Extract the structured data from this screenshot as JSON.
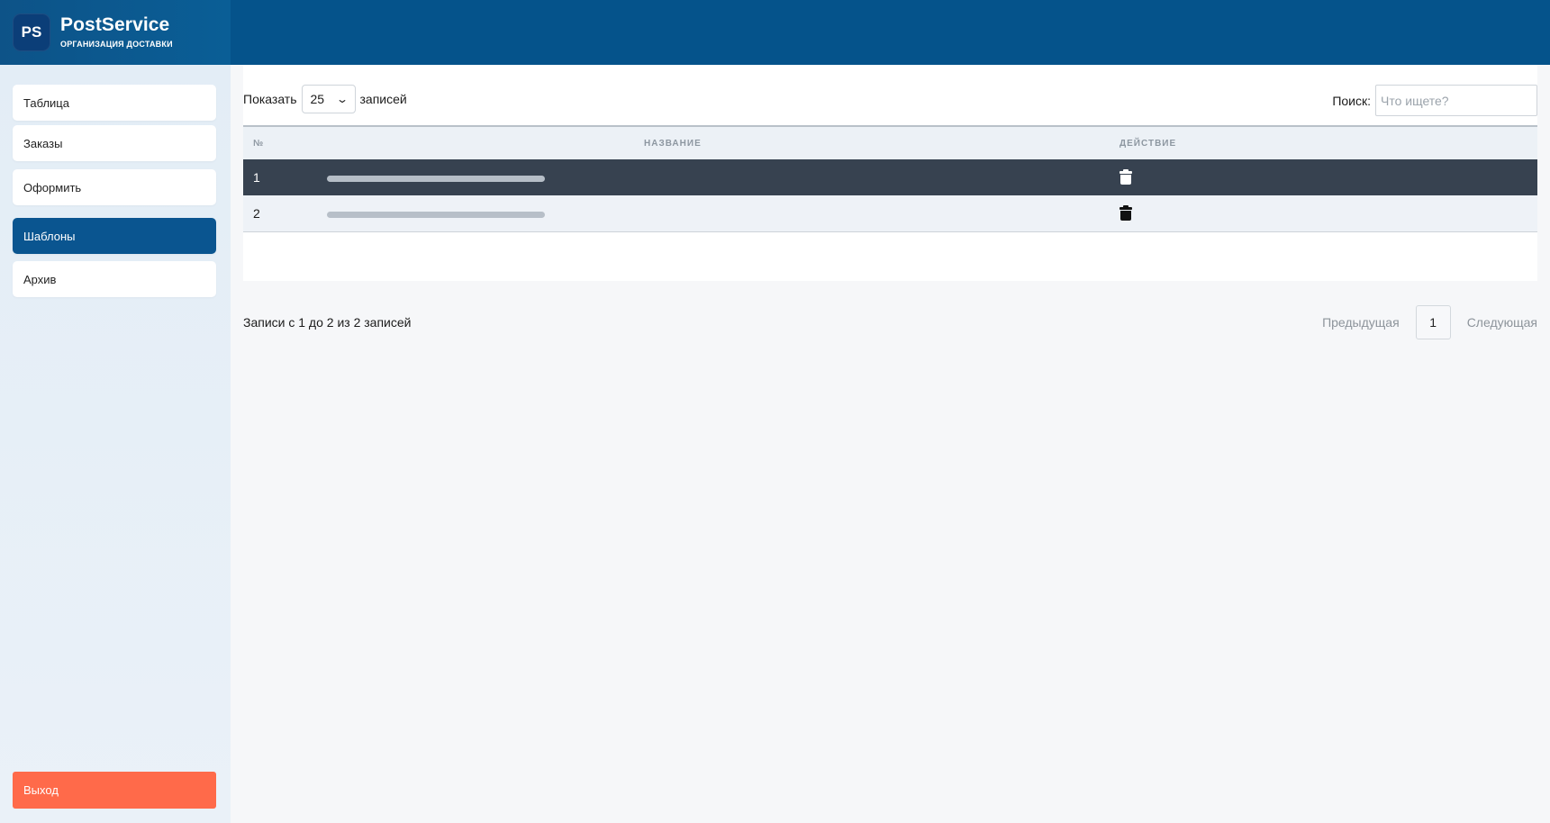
{
  "brand": {
    "logo_text": "PS",
    "title": "PostService",
    "subtitle": "ОРГАНИЗАЦИЯ ДОСТАВКИ"
  },
  "sidebar": {
    "items": [
      {
        "label": "Таблица",
        "active": false
      },
      {
        "label": "Заказы",
        "active": false
      },
      {
        "label": "Оформить",
        "active": false
      },
      {
        "label": "Шаблоны",
        "active": true
      },
      {
        "label": "Архив",
        "active": false
      }
    ],
    "logout_label": "Выход"
  },
  "controls": {
    "show_label": "Показать",
    "page_size": "25",
    "records_label": "записей",
    "search_label": "Поиск:",
    "search_placeholder": "Что ищете?",
    "search_value": ""
  },
  "table": {
    "headers": [
      "№",
      "НАЗВАНИЕ",
      "ДЕЙСТВИЕ"
    ],
    "rows": [
      {
        "num": "1",
        "name": "",
        "action_icon": "trash-icon",
        "selected": true
      },
      {
        "num": "2",
        "name": "",
        "action_icon": "trash-icon",
        "selected": false
      }
    ]
  },
  "footer": {
    "info": "Записи с 1 до 2 из 2 записей",
    "prev_label": "Предыдущая",
    "current_page": "1",
    "next_label": "Следующая"
  },
  "colors": {
    "header_bg": "#05538b",
    "active_nav": "#0a5590",
    "logout_bg": "#ff6a4a",
    "selected_row": "#374250"
  }
}
